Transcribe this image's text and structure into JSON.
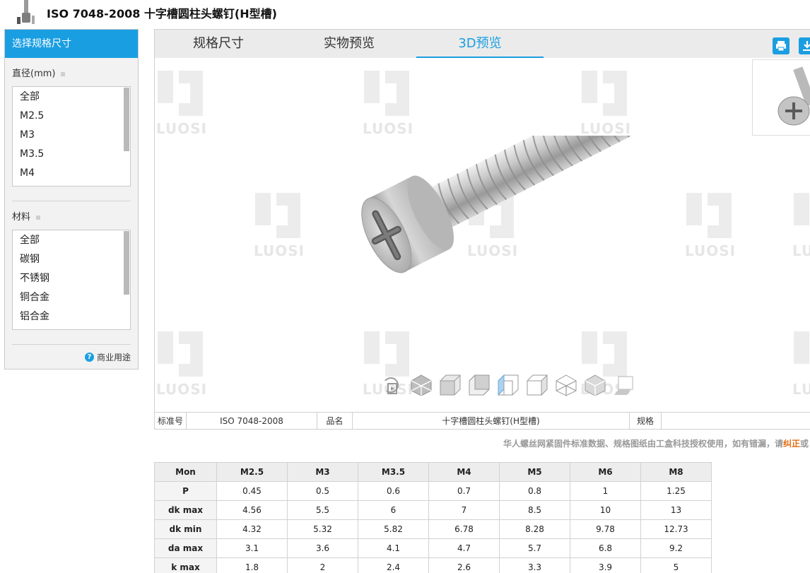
{
  "header": {
    "title": "ISO 7048-2008 十字槽圆柱头螺钉(H型槽)",
    "icon": "screw-product-icon"
  },
  "sidebar": {
    "heading": "选择规格尺寸",
    "filters": [
      {
        "label": "直径(mm)",
        "items": [
          "全部",
          "M2.5",
          "M3",
          "M3.5",
          "M4"
        ]
      },
      {
        "label": "材料",
        "items": [
          "全部",
          "碳钢",
          "不锈钢",
          "铜合金",
          "铝合金"
        ]
      }
    ],
    "usage_label": "商业用途",
    "usage_icon": "help-icon"
  },
  "tabs": [
    {
      "label": "规格尺寸",
      "active": false
    },
    {
      "label": "实物预览",
      "active": false
    },
    {
      "label": "3D预览",
      "active": true
    }
  ],
  "toolbar": {
    "print_icon": "print-icon",
    "download_icon": "download-icon"
  },
  "watermark": {
    "text": "LUOSI"
  },
  "view_controls": [
    "rotate-view-icon",
    "iso-view-icon",
    "front-view-icon",
    "back-view-icon",
    "left-view-icon",
    "right-view-icon",
    "top-view-icon",
    "bottom-view-icon",
    "fullscreen-icon"
  ],
  "info": {
    "standard_label": "标准号",
    "standard_value": "ISO 7048-2008",
    "name_label": "品名",
    "name_value": "十字槽圆柱头螺钉(H型槽)",
    "spec_label": "规格",
    "spec_value": ""
  },
  "notice": {
    "text": "华人螺丝网紧固件标准数据、规格图纸由工盒科技授权使用，如有错漏，请",
    "accent": "纠正",
    "tail": "或"
  },
  "spec_table": {
    "columns": [
      "Mon",
      "M2.5",
      "M3",
      "M3.5",
      "M4",
      "M5",
      "M6",
      "M8"
    ],
    "rows": [
      [
        "P",
        "0.45",
        "0.5",
        "0.6",
        "0.7",
        "0.8",
        "1",
        "1.25"
      ],
      [
        "dk max",
        "4.56",
        "5.5",
        "6",
        "7",
        "8.5",
        "10",
        "13"
      ],
      [
        "dk min",
        "4.32",
        "5.32",
        "5.82",
        "6.78",
        "8.28",
        "9.78",
        "12.73"
      ],
      [
        "da max",
        "3.1",
        "3.6",
        "4.1",
        "4.7",
        "5.7",
        "6.8",
        "9.2"
      ],
      [
        "k max",
        "1.8",
        "2",
        "2.4",
        "2.6",
        "3.3",
        "3.9",
        "5"
      ]
    ]
  },
  "colors": {
    "accent": "#1a9ee2",
    "notice_accent": "#e46a0c"
  }
}
